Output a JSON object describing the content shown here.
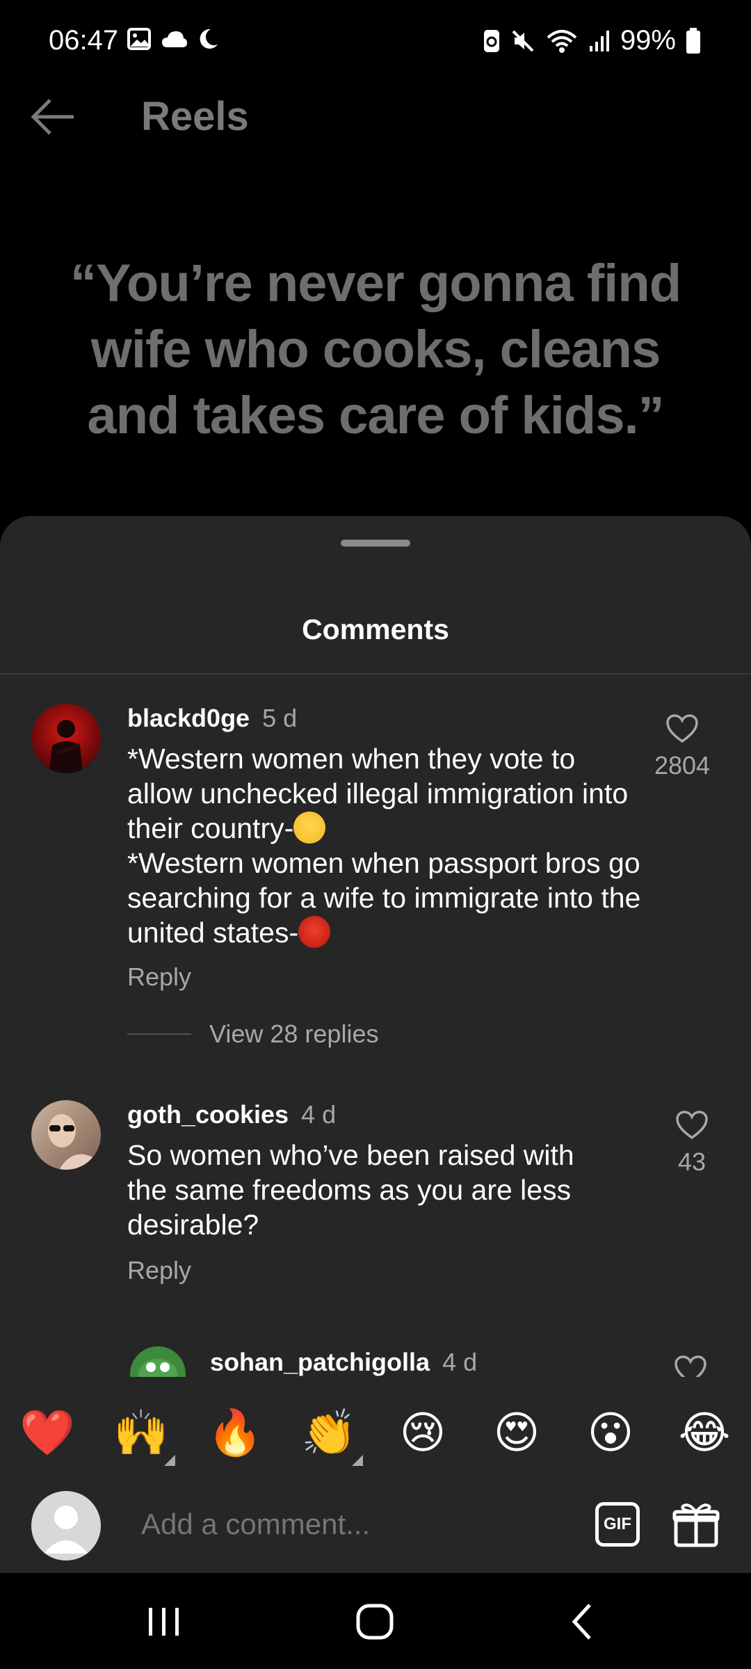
{
  "status_bar": {
    "time": "06:47",
    "battery": "99%",
    "left_icons": [
      "gallery-icon",
      "cloud-icon",
      "moon-icon"
    ],
    "right_icons": [
      "screenshot-icon",
      "mute-icon",
      "wifi-icon",
      "signal-icon",
      "battery-icon"
    ]
  },
  "topbar": {
    "title": "Reels"
  },
  "reel": {
    "quote": "“You’re never gonna find wife who cooks, cleans and takes care of kids.”"
  },
  "sheet": {
    "title": "Comments",
    "comments": [
      {
        "user": "blackd0ge",
        "time": "5 d",
        "lines": [
          "*Western women when they vote to allow unchecked illegal immigration into their country-",
          "*Western women when passport bros go searching for a wife to immigrate into the united states-"
        ],
        "line_emojis": [
          "smiling-face-emoji",
          "cursing-face-emoji"
        ],
        "likes": "2804",
        "reply_label": "Reply",
        "view_replies": "View 28 replies"
      },
      {
        "user": "goth_cookies",
        "time": "4 d",
        "text": "So women who’ve been raised with the same freedoms as you are less desirable?",
        "likes": "43",
        "reply_label": "Reply"
      },
      {
        "user": "sohan_patchigolla",
        "time": "4 d"
      }
    ]
  },
  "emoji_bar": [
    "❤️",
    "🙌",
    "🔥",
    "👏",
    "😢",
    "😍",
    "😮",
    "😂"
  ],
  "input": {
    "placeholder": "Add a comment...",
    "gif_label": "GIF"
  },
  "colors": {
    "sheet_bg": "#262626",
    "secondary_text": "#a8a8a8",
    "quote_text": "#6e6e6e"
  }
}
